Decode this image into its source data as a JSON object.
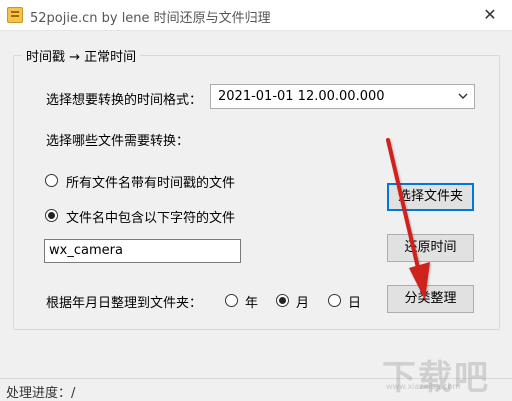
{
  "window": {
    "title": "52pojie.cn by lene 时间还原与文件归理",
    "close_glyph": "✕"
  },
  "group": {
    "legend": "时间戳 → 正常时间"
  },
  "format": {
    "label": "选择想要转换的时间格式：",
    "value": "2021-01-01 12.00.00.000"
  },
  "files": {
    "label": "选择哪些文件需要转换：",
    "option_all": "所有文件名带有时间戳的文件",
    "option_contains": "文件名中包含以下字符的文件",
    "selected": "contains",
    "filter_value": "wx_camera"
  },
  "buttons": {
    "select_folder": "选择文件夹",
    "restore_time": "还原时间",
    "classify": "分类整理"
  },
  "organize": {
    "label": "根据年月日整理到文件夹：",
    "year": "年",
    "month": "月",
    "day": "日",
    "selected": "month"
  },
  "status": {
    "text": "处理进度：/"
  },
  "watermark": {
    "text": "下载吧",
    "sub": "www.xiazaiba.com"
  },
  "colors": {
    "annotation_arrow": "#d0201a",
    "focus": "#0078d7"
  }
}
